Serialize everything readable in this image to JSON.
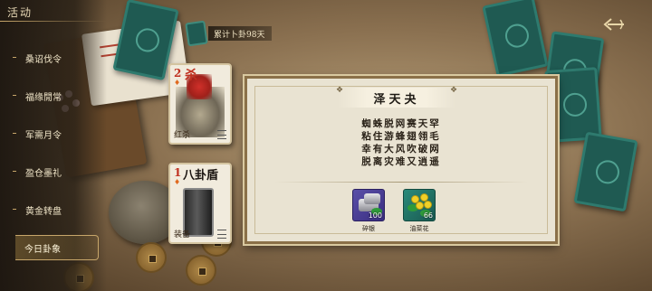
{
  "sidebar": {
    "title": "活动",
    "items": [
      {
        "label": "桑诏伐令"
      },
      {
        "label": "福缘閒常"
      },
      {
        "label": "军需月令"
      },
      {
        "label": "盈仓墨礼"
      },
      {
        "label": "黄金转盘"
      },
      {
        "label": "今日卦象",
        "active": true
      }
    ]
  },
  "counter": {
    "text": "累计卜卦98天"
  },
  "cards": [
    {
      "cost": "2",
      "name": "杀",
      "label": "红杀"
    },
    {
      "cost": "1",
      "name": "八卦盾",
      "label": "装备"
    }
  ],
  "panel": {
    "title": "泽天夬",
    "verses": [
      "蜘蛛脱网赛天罕",
      "粘住游蜂翅翎毛",
      "幸有大风吹破网",
      "脱离灾难又逍遥"
    ],
    "rewards": [
      {
        "name": "碎银",
        "qty": "100",
        "icon": "silver-ingot-icon"
      },
      {
        "name": "油菜花",
        "qty": "66",
        "icon": "rapeseed-flower-icon"
      }
    ]
  },
  "colors": {
    "panel_bg": "#e9e3d2",
    "accent_gold": "#c7a66a",
    "green_card": "#1f5a52",
    "card_cost_red": "#c03020"
  }
}
